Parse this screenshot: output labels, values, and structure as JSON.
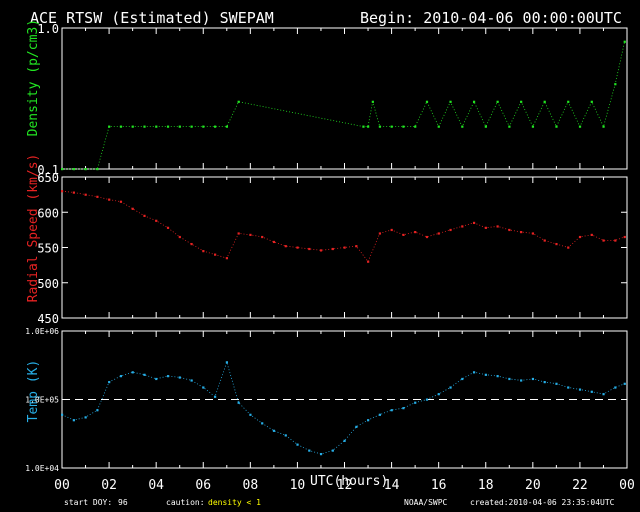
{
  "header": {
    "title": "ACE RTSW (Estimated) SWEPAM",
    "begin": "Begin: 2010-04-06 00:00:00UTC"
  },
  "footer": {
    "start_doy_label": "start DOY:",
    "start_doy_value": "96",
    "caution_label": "caution:",
    "caution_value": "density < 1",
    "source": "NOAA/SWPC",
    "created": "created:2010-04-06 23:35:04UTC"
  },
  "colors": {
    "density": "#22e622",
    "speed": "#e62222",
    "temp": "#27aee6",
    "axes": "#ffffff",
    "caution": "#ffff00"
  },
  "chart_data": [
    {
      "type": "scatter",
      "name": "density-panel",
      "ylabel": "Density (p/cm3)",
      "yscale": "log",
      "ylim": [
        0.1,
        1.0
      ],
      "yticks": [
        "1.0",
        "0.1"
      ],
      "x": [
        0,
        0.5,
        1,
        1.5,
        2,
        2.5,
        3,
        3.5,
        4,
        4.5,
        5,
        5.5,
        6,
        6.5,
        7,
        7.5,
        12.8,
        13,
        13.2,
        13.5,
        14,
        14.5,
        15,
        15.5,
        16,
        16.5,
        17,
        17.5,
        18,
        18.5,
        19,
        19.5,
        20,
        20.5,
        21,
        21.5,
        22,
        22.5,
        23,
        23.5,
        23.9
      ],
      "y": [
        0.1,
        0.1,
        0.1,
        0.1,
        0.2,
        0.2,
        0.2,
        0.2,
        0.2,
        0.2,
        0.2,
        0.2,
        0.2,
        0.2,
        0.2,
        0.3,
        0.2,
        0.2,
        0.3,
        0.2,
        0.2,
        0.2,
        0.2,
        0.3,
        0.2,
        0.3,
        0.2,
        0.3,
        0.2,
        0.3,
        0.2,
        0.3,
        0.2,
        0.3,
        0.2,
        0.3,
        0.2,
        0.3,
        0.2,
        0.4,
        0.8
      ]
    },
    {
      "type": "scatter",
      "name": "speed-panel",
      "ylabel": "Radial Speed (km/s)",
      "ylim": [
        450,
        650
      ],
      "yticks": [
        450,
        500,
        550,
        600,
        650
      ],
      "x": [
        0,
        0.5,
        1,
        1.5,
        2,
        2.5,
        3,
        3.5,
        4,
        4.5,
        5,
        5.5,
        6,
        6.5,
        7,
        7.5,
        8,
        8.5,
        9,
        9.5,
        10,
        10.5,
        11,
        11.5,
        12,
        12.5,
        13,
        13.5,
        14,
        14.5,
        15,
        15.5,
        16,
        16.5,
        17,
        17.5,
        18,
        18.5,
        19,
        19.5,
        20,
        20.5,
        21,
        21.5,
        22,
        22.5,
        23,
        23.5,
        23.9
      ],
      "y": [
        630,
        628,
        625,
        622,
        618,
        615,
        605,
        595,
        588,
        578,
        565,
        555,
        545,
        540,
        535,
        570,
        568,
        565,
        558,
        552,
        550,
        548,
        546,
        548,
        550,
        552,
        530,
        570,
        575,
        568,
        572,
        565,
        570,
        575,
        580,
        585,
        578,
        580,
        575,
        572,
        570,
        560,
        555,
        550,
        565,
        568,
        560,
        560,
        565
      ]
    },
    {
      "type": "scatter",
      "name": "temp-panel",
      "ylabel": "Temp (K)",
      "yscale": "log",
      "ylim": [
        10000,
        1000000
      ],
      "yticks": [
        "1.0E+06",
        "1.0E+05",
        "1.0E+04"
      ],
      "reference_line": 100000,
      "x": [
        0,
        0.5,
        1,
        1.5,
        2,
        2.5,
        3,
        3.5,
        4,
        4.5,
        5,
        5.5,
        6,
        6.5,
        7,
        7.5,
        8,
        8.5,
        9,
        9.5,
        10,
        10.5,
        11,
        11.5,
        12,
        12.5,
        13,
        13.5,
        14,
        14.5,
        15,
        15.5,
        16,
        16.5,
        17,
        17.5,
        18,
        18.5,
        19,
        19.5,
        20,
        20.5,
        21,
        21.5,
        22,
        22.5,
        23,
        23.5,
        23.9
      ],
      "y": [
        60000,
        50000,
        55000,
        70000,
        180000,
        220000,
        250000,
        230000,
        200000,
        220000,
        210000,
        190000,
        150000,
        110000,
        350000,
        90000,
        60000,
        45000,
        35000,
        30000,
        22000,
        18000,
        16000,
        18000,
        25000,
        40000,
        50000,
        60000,
        70000,
        75000,
        90000,
        100000,
        120000,
        150000,
        200000,
        250000,
        230000,
        220000,
        200000,
        190000,
        200000,
        180000,
        170000,
        150000,
        140000,
        130000,
        120000,
        150000,
        170000
      ]
    }
  ],
  "xaxis": {
    "label": "UTC(hours)",
    "ticks": [
      "00",
      "02",
      "04",
      "06",
      "08",
      "10",
      "12",
      "14",
      "16",
      "18",
      "20",
      "22",
      "00"
    ]
  }
}
